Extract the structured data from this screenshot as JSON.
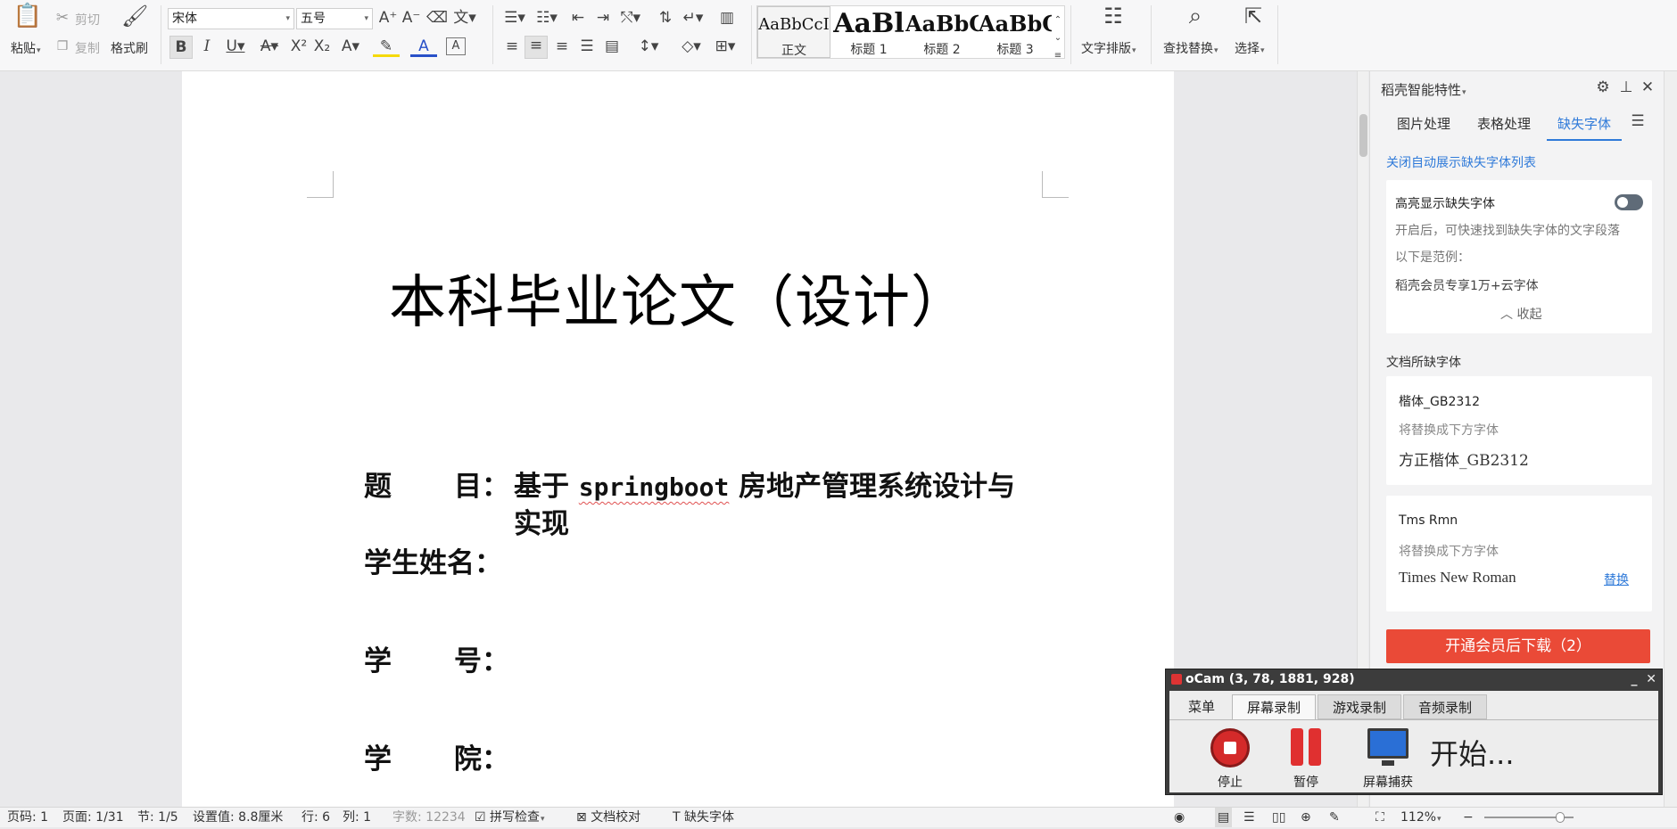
{
  "ribbon": {
    "clipboard": {
      "paste": "粘贴",
      "cut": "剪切",
      "copy": "复制",
      "format_painter": "格式刷"
    },
    "font": {
      "family": "宋体",
      "size": "五号"
    },
    "styles": [
      {
        "preview": "AaBbCcI",
        "label": "正文"
      },
      {
        "preview": "AaBl",
        "label": "标题 1"
      },
      {
        "preview": "AaBbC",
        "label": "标题 2"
      },
      {
        "preview": "AaBbC",
        "label": "标题 3"
      }
    ],
    "text_layout": "文字排版",
    "find_replace": "查找替换",
    "select": "选择"
  },
  "document": {
    "title": "本科毕业论文（设计）",
    "fields": [
      {
        "label": "题目",
        "colon": "：",
        "value_prefix": "基于 ",
        "value_mono": "springboot",
        "value_suffix": " 房地产管理系统设计与",
        "value_line2": "实现"
      },
      {
        "label": "学生姓名",
        "colon": "："
      },
      {
        "label": "学号",
        "colon": "："
      },
      {
        "label": "学院",
        "colon": "："
      }
    ]
  },
  "panel": {
    "title": "稻壳智能特性",
    "tabs": [
      "图片处理",
      "表格处理",
      "缺失字体"
    ],
    "active_tab": 2,
    "auto_show_link": "关闭自动展示缺失字体列表",
    "highlight": {
      "title": "高亮显示缺失字体",
      "desc": "开启后，可快速找到缺失字体的文字段落",
      "example_intro": "以下是范例：",
      "example": "稻壳会员专享1万+云字体",
      "collapse": "收起"
    },
    "missing_heading": "文档所缺字体",
    "missing_fonts": [
      {
        "name": "楷体_GB2312",
        "hint": "将替换成下方字体",
        "replacement": "方正楷体_GB2312",
        "action": ""
      },
      {
        "name": "Tms Rmn",
        "hint": "将替换成下方字体",
        "replacement": "Times New Roman",
        "action": "替换"
      }
    ],
    "download_button": "开通会员后下载（2）"
  },
  "ocam": {
    "title": "oCam (3, 78, 1881, 928)",
    "tabs": [
      "菜单",
      "屏幕录制",
      "游戏录制",
      "音频录制"
    ],
    "active_tab": 1,
    "tools": [
      "停止",
      "暂停",
      "屏幕捕获"
    ],
    "status": "开始..."
  },
  "statusbar": {
    "page_num": "页码: 1",
    "page": "页面: 1/31",
    "section": "节: 1/5",
    "setting": "设置值: 8.8厘米",
    "row": "行: 6",
    "col": "列: 1",
    "word_count": "字数: 12234",
    "spell_check": "拼写检查",
    "doc_proof": "文档校对",
    "missing_font": "缺失字体",
    "zoom": "112%"
  }
}
